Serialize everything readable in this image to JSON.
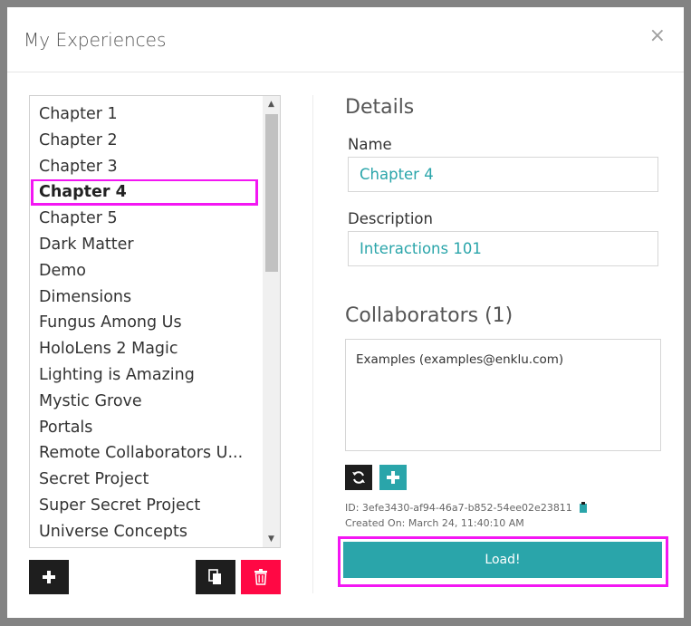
{
  "dialog": {
    "title": "My Experiences",
    "close_symbol": "×"
  },
  "experiences": {
    "items": [
      {
        "label": "Chapter 1"
      },
      {
        "label": "Chapter 2"
      },
      {
        "label": "Chapter 3"
      },
      {
        "label": "Chapter 4",
        "selected": true
      },
      {
        "label": "Chapter 5"
      },
      {
        "label": "Dark Matter"
      },
      {
        "label": "Demo"
      },
      {
        "label": "Dimensions"
      },
      {
        "label": "Fungus Among Us"
      },
      {
        "label": "HoloLens 2 Magic"
      },
      {
        "label": "Lighting is Amazing"
      },
      {
        "label": "Mystic Grove"
      },
      {
        "label": "Portals"
      },
      {
        "label": "Remote Collaborators U..."
      },
      {
        "label": "Secret Project"
      },
      {
        "label": "Super Secret Project"
      },
      {
        "label": "Universe Concepts"
      }
    ],
    "highlight_color": "#f316f3"
  },
  "list_actions": {
    "add_icon": "plus-icon",
    "copy_icon": "copy-icon",
    "delete_icon": "trash-icon",
    "delete_color": "#ff0844"
  },
  "details": {
    "heading": "Details",
    "name_label": "Name",
    "name_value": "Chapter 4",
    "description_label": "Description",
    "description_value": "Interactions 101"
  },
  "collaborators": {
    "heading": "Collaborators (1)",
    "items": [
      {
        "label": "Examples (examples@enklu.com)"
      }
    ]
  },
  "meta": {
    "id_text": "ID: 3efe3430-af94-46a7-b852-54ee02e23811",
    "created_text": "Created On: March 24, 11:40:10 AM"
  },
  "load_button": {
    "label": "Load!",
    "color": "#2aa5aa"
  }
}
